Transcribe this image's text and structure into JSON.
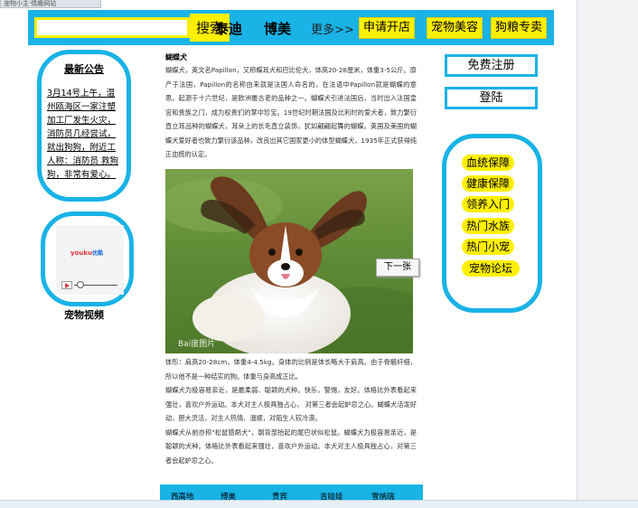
{
  "browser": {
    "tab_title": "宠物小主·情趣网站"
  },
  "header": {
    "search_placeholder": "",
    "search_button": "搜索",
    "nav": [
      "泰迪",
      "博美"
    ],
    "more": "更多>>",
    "links": [
      "申请开店",
      "宠物美容",
      "狗粮专卖"
    ]
  },
  "sidebar_left": {
    "notice_title": "最新公告",
    "notice_text": "3月14号上午，温州瓯海区一家注塑加工厂发生火灾，消防员几经尝试，就出狗狗，附近工人称：消防员 救狗狗，非常有爱心。",
    "video_brand": "youku",
    "video_brand_suffix": "优酷",
    "video_label": "宠物视频"
  },
  "article": {
    "title": "蝴蝶犬",
    "paragraph1": "蝴蝶犬，英文名Papillon，又称蝶耳犬和巴比伦犬，体高20-28厘米，体重3-5公斤。原产于法国，Papillon的名称由来就是法国人命名的，在法语中Papillon就是蝴蝶的意思。起源于十六世纪，是欧洲最古老的品种之一。蝴蝶犬引进法国后，当时出入法国皇宫和贵族之门，成为权贵们的掌中珍宝。19世纪时期法国及比利时的爱犬者，致力繁衍直立耳品种的蝴蝶犬，耳朵上的长毛直立装饰，犹如翩翩起舞的蝴蝶。英国及美国的蝴蝶犬爱好者也致力繁衍该品种，改良出其它国家更小的体型蝴蝶犬，1935年正式获得纯正血统的认定。",
    "next_button": "下一张",
    "watermark": "Bai度图片",
    "paragraph2": "体形：肩高20-28cm，体重4-4.5kg。身体的比例是体长略大于肩高。由于骨骼纤细，所以他不是一种结实的狗。体重与身高成正比。",
    "paragraph3": "蝴蝶犬为极容易亲近，是最柔弱、聪颖的犬种。快乐，警惕，友好。体格比外表看起来强壮，喜欢户外运动。本犬对主人极具独占心， 对第三者会起妒忌之心。蝴蝶犬活泼好动，胆大灵活，对主人热情、温顺，对陌生人较冷漠。",
    "paragraph4": "蝴蝶犬从前亦称\"松鼠猎鹬犬\"，朝背部抬起的尾巴状似松鼠。蝴蝶犬为极容易亲近，是聪颖的犬种。体格比外表看起来强壮，喜欢户外运动。本犬对主人极具独占心，对第三者会起妒忌之心。"
  },
  "breeds": [
    "西高地",
    "博美",
    "贵宾",
    "吉娃娃",
    "雪纳瑞"
  ],
  "sidebar_right": {
    "register": "免费注册",
    "login": "登陆",
    "features": [
      "血统保障",
      "健康保障",
      "领养入门",
      "热门水族",
      "热门小宠",
      "宠物论坛"
    ]
  },
  "colors": {
    "accent_blue": "#19b3e6",
    "accent_yellow": "#fff000"
  }
}
